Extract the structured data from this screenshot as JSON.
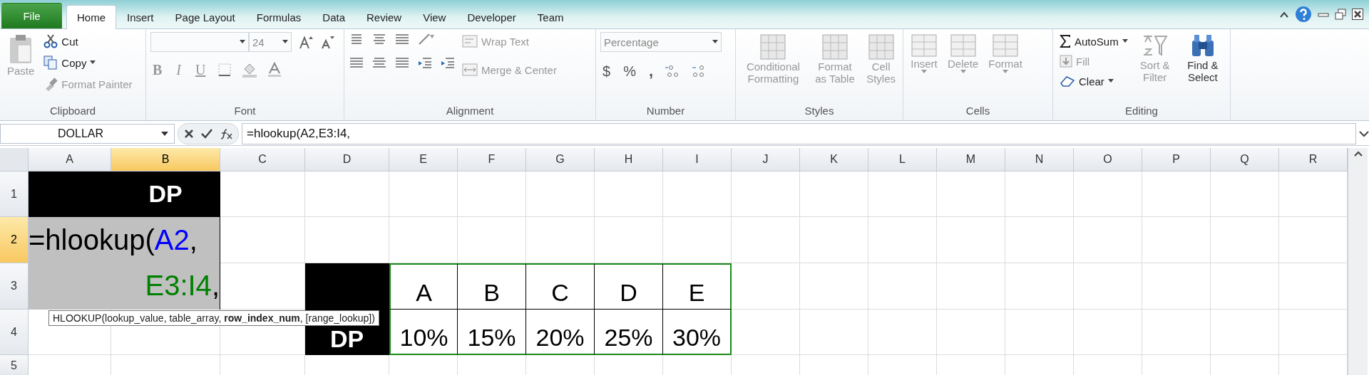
{
  "tabs": [
    {
      "label": "File",
      "kind": "file",
      "selected": false
    },
    {
      "label": "Home",
      "kind": "tab",
      "selected": true
    },
    {
      "label": "Insert",
      "kind": "tab",
      "selected": false
    },
    {
      "label": "Page Layout",
      "kind": "tab",
      "selected": false
    },
    {
      "label": "Formulas",
      "kind": "tab",
      "selected": false
    },
    {
      "label": "Data",
      "kind": "tab",
      "selected": false
    },
    {
      "label": "Review",
      "kind": "tab",
      "selected": false
    },
    {
      "label": "View",
      "kind": "tab",
      "selected": false
    },
    {
      "label": "Developer",
      "kind": "tab",
      "selected": false
    },
    {
      "label": "Team",
      "kind": "tab",
      "selected": false
    }
  ],
  "ribbon": {
    "clipboard": {
      "label": "Clipboard",
      "paste": {
        "label": "Paste",
        "disabled": true
      },
      "cut": {
        "label": "Cut",
        "disabled": false
      },
      "copy": {
        "label": "Copy",
        "disabled": false
      },
      "format_painter": {
        "label": "Format Painter",
        "disabled": true
      }
    },
    "font": {
      "label": "Font",
      "font_size": "24",
      "bold": {
        "label": "B"
      },
      "italic": {
        "label": "I"
      },
      "underline": {
        "label": "U"
      }
    },
    "alignment": {
      "label": "Alignment",
      "wrap_text": {
        "label": "Wrap Text",
        "disabled": true
      },
      "merge_center": {
        "label": "Merge & Center",
        "disabled": true
      }
    },
    "number": {
      "label": "Number",
      "format": "Percentage",
      "currency": "$",
      "percent": "%",
      "comma": ","
    },
    "styles": {
      "label": "Styles",
      "buttons": [
        {
          "label": "Conditional Formatting",
          "disabled": true
        },
        {
          "label": "Format as Table",
          "disabled": true
        },
        {
          "label": "Cell Styles",
          "disabled": true
        }
      ]
    },
    "cells": {
      "label": "Cells",
      "buttons": [
        {
          "label": "Insert",
          "disabled": true
        },
        {
          "label": "Delete",
          "disabled": true
        },
        {
          "label": "Format",
          "disabled": true
        }
      ]
    },
    "editing": {
      "label": "Editing",
      "autosum": {
        "label": "AutoSum",
        "disabled": false
      },
      "fill": {
        "label": "Fill",
        "disabled": true
      },
      "clear": {
        "label": "Clear",
        "disabled": false
      },
      "sort_filter": {
        "label": "Sort & Filter",
        "disabled": true
      },
      "find_select": {
        "label": "Find & Select",
        "disabled": false
      }
    }
  },
  "formula_bar": {
    "name_box": "DOLLAR",
    "formula": "=hlookup(A2,E3:I4,"
  },
  "sheet": {
    "columns": [
      {
        "label": "A",
        "selected": false
      },
      {
        "label": "B",
        "selected": true
      },
      {
        "label": "C",
        "selected": false
      },
      {
        "label": "D",
        "selected": false
      },
      {
        "label": "E",
        "selected": false
      },
      {
        "label": "F",
        "selected": false
      },
      {
        "label": "G",
        "selected": false
      },
      {
        "label": "H",
        "selected": false
      },
      {
        "label": "I",
        "selected": false
      },
      {
        "label": "J",
        "selected": false
      },
      {
        "label": "K",
        "selected": false
      },
      {
        "label": "L",
        "selected": false
      },
      {
        "label": "M",
        "selected": false
      },
      {
        "label": "N",
        "selected": false
      },
      {
        "label": "O",
        "selected": false
      },
      {
        "label": "P",
        "selected": false
      },
      {
        "label": "Q",
        "selected": false
      },
      {
        "label": "R",
        "selected": false
      }
    ],
    "rows": [
      {
        "header": "1",
        "selected": false,
        "cells": [
          {
            "kind": "dark"
          },
          {
            "kind": "dark",
            "text": "DP"
          }
        ]
      },
      {
        "header": "2",
        "selected": true,
        "cells": [
          {
            "kind": "editing"
          },
          {
            "kind": "editing"
          }
        ]
      },
      {
        "header": "3",
        "selected": false,
        "cells": [
          {
            "kind": "editing"
          },
          {
            "kind": "editing"
          },
          {
            "kind": "blank"
          },
          {
            "kind": "dark"
          },
          {
            "kind": "table",
            "text": "A",
            "in_range": true
          },
          {
            "kind": "table",
            "text": "B",
            "in_range": true
          },
          {
            "kind": "table",
            "text": "C",
            "in_range": true
          },
          {
            "kind": "table",
            "text": "D",
            "in_range": true
          },
          {
            "kind": "table",
            "text": "E",
            "in_range": true
          }
        ]
      },
      {
        "header": "4",
        "selected": false,
        "cells": [
          {
            "kind": "blank"
          },
          {
            "kind": "blank"
          },
          {
            "kind": "blank"
          },
          {
            "kind": "dark",
            "text": "DP"
          },
          {
            "kind": "table",
            "text": "10%",
            "in_range": true
          },
          {
            "kind": "table",
            "text": "15%",
            "in_range": true
          },
          {
            "kind": "table",
            "text": "20%",
            "in_range": true
          },
          {
            "kind": "table",
            "text": "25%",
            "in_range": true
          },
          {
            "kind": "table",
            "text": "30%",
            "in_range": true
          }
        ]
      },
      {
        "header": "5",
        "selected": false,
        "cells": []
      }
    ],
    "cell_editor": {
      "lines": [
        [
          {
            "text": "=hlookup(",
            "color": "#000000"
          },
          {
            "text": "A2",
            "color": "#0000ff"
          },
          {
            "text": ",",
            "color": "#000000"
          }
        ],
        [
          {
            "text": "E3:I4",
            "color": "#008000"
          },
          {
            "text": ",",
            "color": "#000000"
          }
        ]
      ]
    },
    "tooltip": "HLOOKUP(lookup_value, table_array, **row_index_num**, [range_lookup])"
  }
}
